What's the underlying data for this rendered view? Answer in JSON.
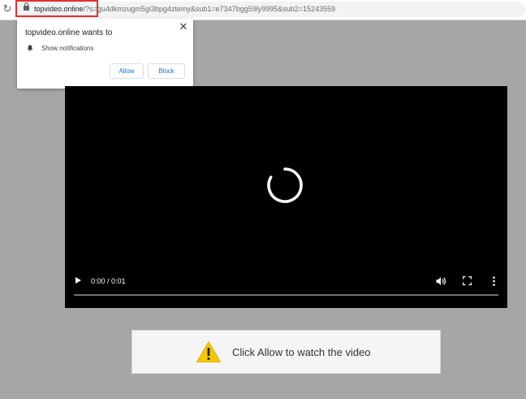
{
  "browser": {
    "url_host": "topvideo.online",
    "url_rest": "/?s=gu4dkmzugm5gi3bpg4ztemy&sub1=e7347bgg59ly9995&sub2=15243559"
  },
  "notification_prompt": {
    "title": "topvideo.online wants to",
    "permission": "Show notifications",
    "allow_label": "Allow",
    "block_label": "Block"
  },
  "video": {
    "time": "0:00 / 0:01",
    "progress": 0.0
  },
  "banner": {
    "text": "Click Allow to watch the video"
  },
  "icons": [
    "reload-icon",
    "lock-icon",
    "close-icon",
    "bell-icon",
    "spinner-icon",
    "play-icon",
    "volume-icon",
    "fullscreen-icon",
    "more-icon",
    "warning-icon"
  ],
  "colors": {
    "page_background": "#a6a6a6",
    "highlight": "#e0312e",
    "button_text": "#1a73e8",
    "warning_fill": "#f6c700"
  }
}
